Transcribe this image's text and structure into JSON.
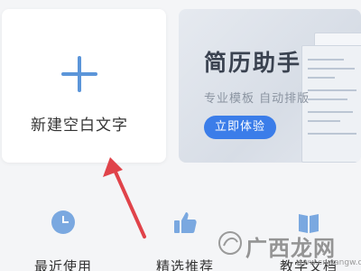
{
  "new_card": {
    "label": "新建空白文字",
    "icon": "plus-icon"
  },
  "resume_card": {
    "title": "简历助手",
    "subtitle": "专业模板 自动排版",
    "button_label": "立即体验"
  },
  "bottom_nav": [
    {
      "label": "最近使用",
      "icon": "clock-icon"
    },
    {
      "label": "精选推荐",
      "icon": "thumbs-up-icon"
    },
    {
      "label": "教学文档",
      "icon": "book-icon"
    }
  ],
  "annotation": {
    "arrow_color": "#e0434a"
  },
  "watermark": {
    "text": "广西龙网",
    "url": "www.cnwangw.com"
  },
  "colors": {
    "accent": "#3b7de9",
    "icon_blue": "#7aa8e0"
  }
}
